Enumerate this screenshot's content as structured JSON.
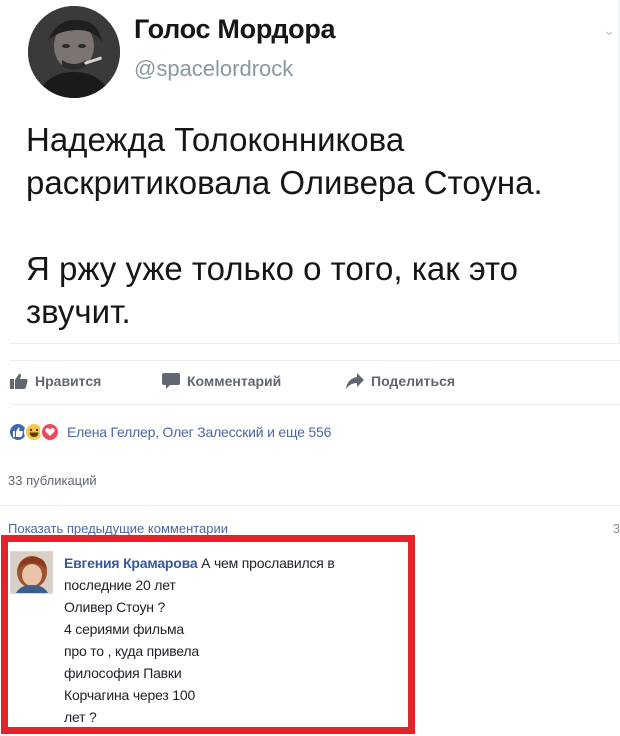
{
  "tweet": {
    "author_name": "Голос Мордора",
    "author_handle": "@spacelordrock",
    "paragraph_1": "Надежда Толоконникова раскритиковала Оливера Стоуна.",
    "paragraph_2": "Я ржу уже только о того, как это звучит."
  },
  "actions": {
    "like": "Нравится",
    "comment": "Комментарий",
    "share": "Поделиться"
  },
  "reactions": {
    "icons": [
      "like-icon",
      "haha-icon",
      "love-icon"
    ],
    "summary": "Елена Геллер, Олег Залесский и еще 556"
  },
  "shares_count": "33 публикаций",
  "comments": {
    "show_previous": "Показать предыдущие комментарии",
    "count": "3",
    "highlighted": {
      "author": "Евгения Крамарова",
      "first_line": "А чем прославился в",
      "lines": [
        "последние 20 лет",
        "Оливер Стоун ?",
        "4 сериями фильма",
        "про то , куда привела",
        "философия Павки",
        "Корчагина через 100",
        "лет ?"
      ]
    }
  },
  "colors": {
    "facebook_link": "#385898",
    "highlight_border": "#e4222a",
    "twitter_handle": "#8899a6"
  }
}
